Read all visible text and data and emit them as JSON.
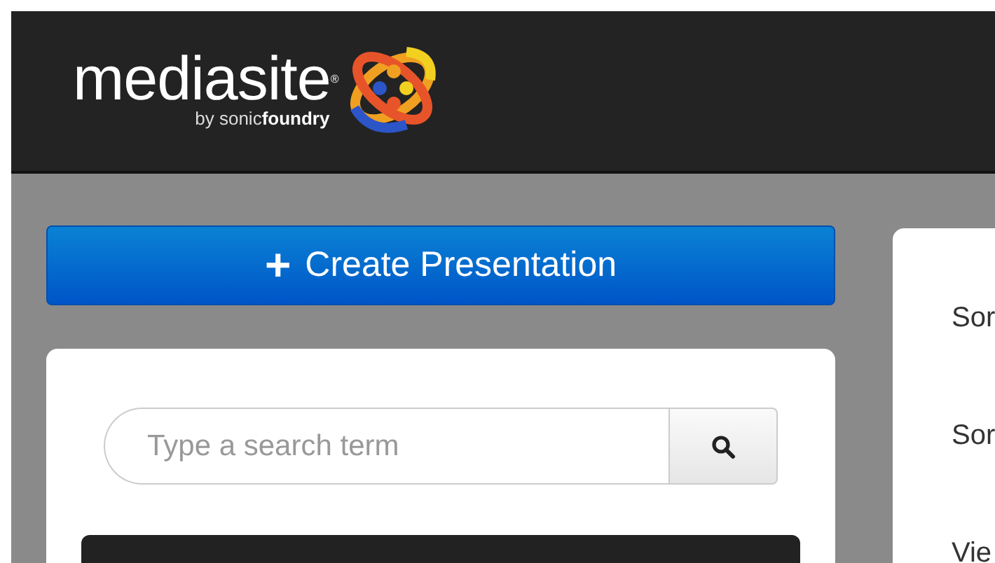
{
  "header": {
    "logo": {
      "name": "mediasite$^{®}$",
      "tagline_prefix": "by sonic",
      "tagline_bold": "foundry"
    }
  },
  "create_button": {
    "icon": "+",
    "label": "Create Presentation"
  },
  "search": {
    "placeholder": "Type a search term"
  },
  "side_panel": {
    "items": [
      "Sor",
      "Sor",
      "Vie"
    ]
  }
}
